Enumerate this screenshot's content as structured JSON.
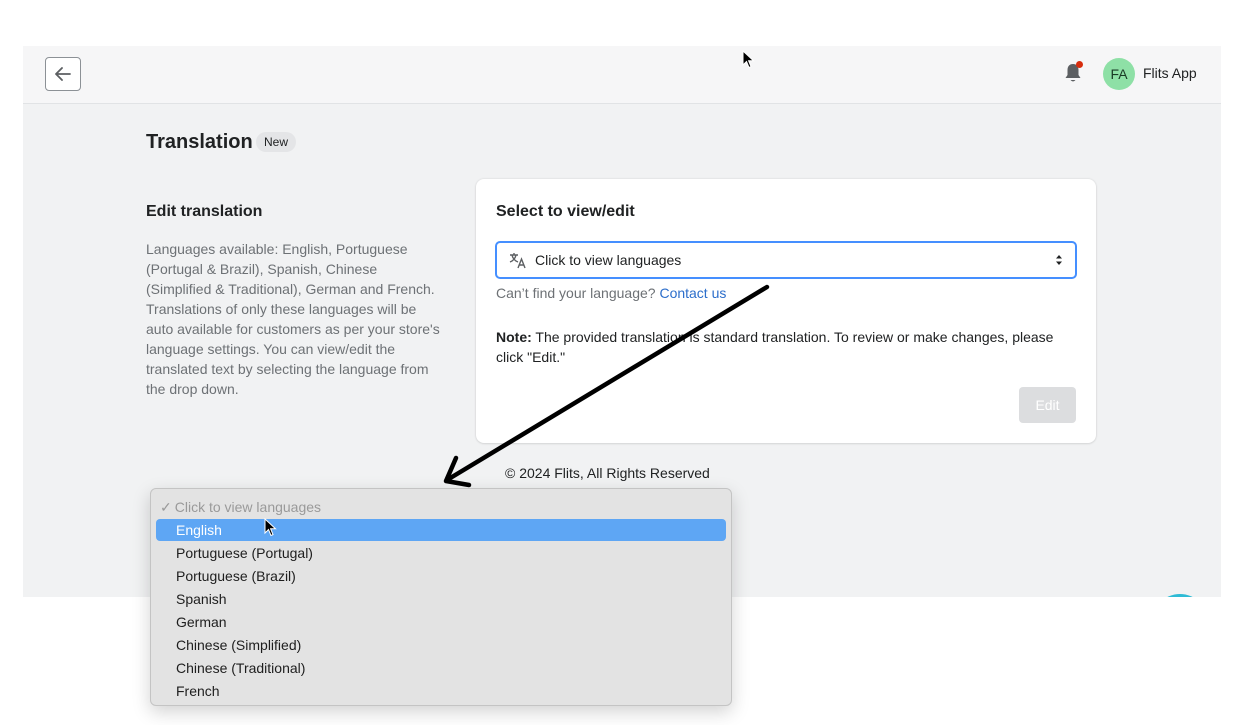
{
  "topbar": {
    "back_label": "Back",
    "avatar_initials": "FA",
    "store_name": "Flits App",
    "notification_dot_color": "#d72c0d"
  },
  "page": {
    "title": "Translation",
    "badge": "New"
  },
  "section": {
    "title": "Edit translation",
    "description": "Languages available: English, Portuguese (Portugal & Brazil), Spanish, Chinese (Simplified & Traditional), German and French. Translations of only these languages will be auto available for customers as per your store's language settings. You can view/edit the translated text by selecting the language from the drop down."
  },
  "card": {
    "title": "Select to view/edit",
    "select_value": "Click to view languages",
    "help_text": "Can’t find your language?",
    "help_link": "Contact us",
    "note_label": "Note:",
    "note_text": " The provided translation is standard translation. To review or make changes, please click \"Edit.\"",
    "edit_label": "Edit"
  },
  "footer": {
    "text": "© 2024 Flits, All Rights Reserved"
  },
  "dropdown": {
    "placeholder_check": "✓",
    "options": [
      "Click to view languages",
      "English",
      "Portuguese (Portugal)",
      "Portuguese (Brazil)",
      "Spanish",
      "German",
      "Chinese (Simplified)",
      "Chinese (Traditional)",
      "French"
    ],
    "highlight_color": "#5ea6f4"
  },
  "colors": {
    "accent": "#458fff",
    "link": "#2c6ecb",
    "annotation_arrow": "#000000"
  }
}
